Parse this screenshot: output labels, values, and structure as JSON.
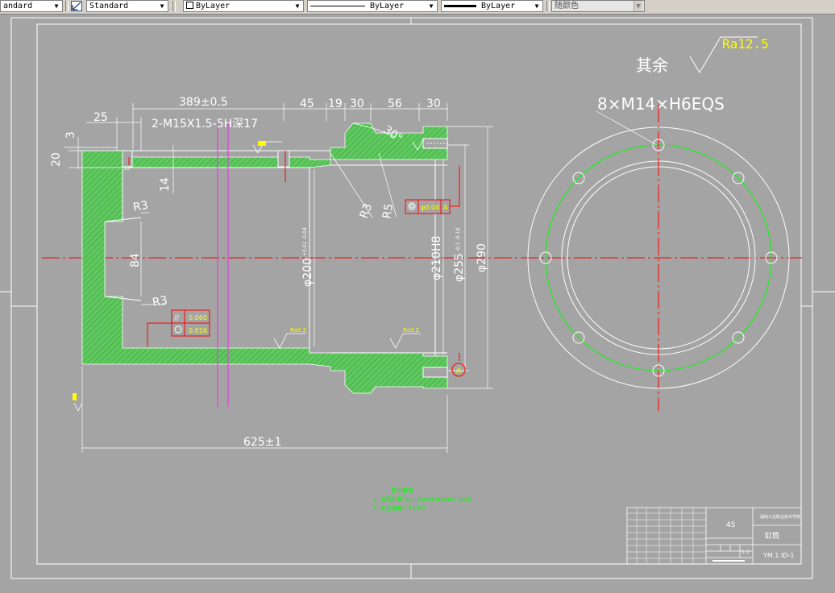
{
  "toolbar": {
    "text_style": "andard",
    "dim_style": "Standard",
    "layer": "ByLayer",
    "linetype": "ByLayer",
    "lineweight": "ByLayer",
    "plotstyle": "随颜色"
  },
  "drawing": {
    "surface_symbol_value": "Ra12.5",
    "surface_rest_label": "其余",
    "dim_389": "389±0.5",
    "dim_45": "45",
    "dim_19": "19",
    "dim_30a": "30",
    "dim_56": "56",
    "dim_30b": "30",
    "dim_25": "25",
    "dim_3": "3",
    "thread_note": "2-M15X1.5-5H深17",
    "dim_20": "20",
    "dim_14": "14",
    "angle_30": "30°",
    "r3_top": "R3",
    "r3_bottom": "R3",
    "r3_inner": "R3",
    "r5": "R5",
    "dim_84": "84",
    "dim_200": "φ200",
    "dim_200_tol": "+0.02  -0.04",
    "dim_210": "φ210H8",
    "dim_255": "φ255",
    "dim_255_tol": "-0.1  -0.18",
    "dim_290": "φ290",
    "dim_625": "625±1",
    "gdt_concentric_value": "φ0.04",
    "gdt_concentric_datum": "A",
    "gdt_parallel_value": "0.060",
    "gdt_round_value": "0.016",
    "ra_left": "Ra0.2",
    "ra_right": "Ra3.2",
    "datum_a": "A",
    "holes_note": "8×M14×H6EQS"
  },
  "notes": {
    "title": "技术要求",
    "line1": "1. 调质处理  20~35HRC(HB207-263)",
    "line2": "2. 未注倒角0.5×45°"
  },
  "title_block": {
    "material": "45",
    "company": "湖南工业职业技术学院",
    "part_name": "缸筒",
    "drawing_no": "YM.1.ID-1",
    "scale": "1:1"
  },
  "colors": {
    "background": "#a4a4a4",
    "hatch": "#5fc85f",
    "center_line": "#ff0000",
    "green": "#00ff00",
    "magenta": "#e040e0",
    "yellow": "#ffff00"
  }
}
